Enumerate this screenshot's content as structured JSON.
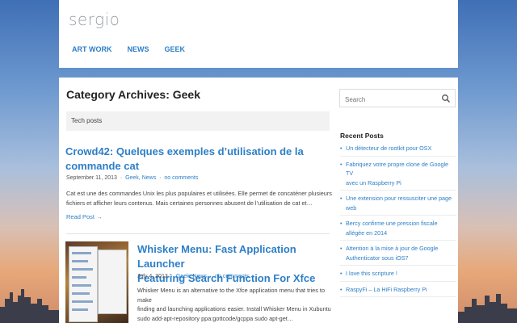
{
  "site": {
    "logo": "sergio"
  },
  "nav": {
    "items": [
      "ART WORK",
      "NEWS",
      "GEEK"
    ]
  },
  "archive": {
    "title": "Category Archives: Geek",
    "description": "Tech posts"
  },
  "posts": [
    {
      "title_line1": "Crowd42: Quelques exemples d’utilisation de la",
      "title_line2": "commande cat",
      "date": "September 11, 2013",
      "cat1": "Geek",
      "cat2": "News",
      "comments": "no comments",
      "excerpt": [
        "Cat est une des commandes Unix les plus populaires et utilisées. Elle permet de concaténer plusieurs",
        "fichiers et afficher leurs contenus. Mais certaines personnes abusent de l’utilisation de cat et…"
      ],
      "read_more": "Read Post →"
    },
    {
      "title_line1": "Whisker Menu: Fast Application Launcher",
      "title_line2": "Featuring Search Function For Xfce",
      "date": "July 4, 2013",
      "cat1": "Geek",
      "cat2": "News",
      "comments": "no comments",
      "excerpt": [
        "Whisker Menu is an alternative to the Xfce application menu that tries to make",
        "finding and launching applications easier.   Install Whisker Menu in Xubuntu",
        "sudo add-apt-repository ppa:gottcode/gcppa sudo apt-get…"
      ]
    }
  ],
  "sidebar": {
    "search_placeholder": "Search",
    "recent_title": "Recent Posts",
    "recent": [
      [
        "Un détecteur de rootkit pour OSX"
      ],
      [
        "Fabriquez votre propre clone de Google TV",
        "avec un Raspberry Pi"
      ],
      [
        "Une extension pour ressusciter une page",
        "web"
      ],
      [
        "Bercy confirme une pression fiscale",
        "allégée en 2014"
      ],
      [
        "Attention à la mise à jour de Google",
        "Authenticator sous iOS7"
      ],
      [
        "I love this scripture !"
      ],
      [
        "RaspyFi – La HiFi Raspberry Pi"
      ]
    ]
  }
}
